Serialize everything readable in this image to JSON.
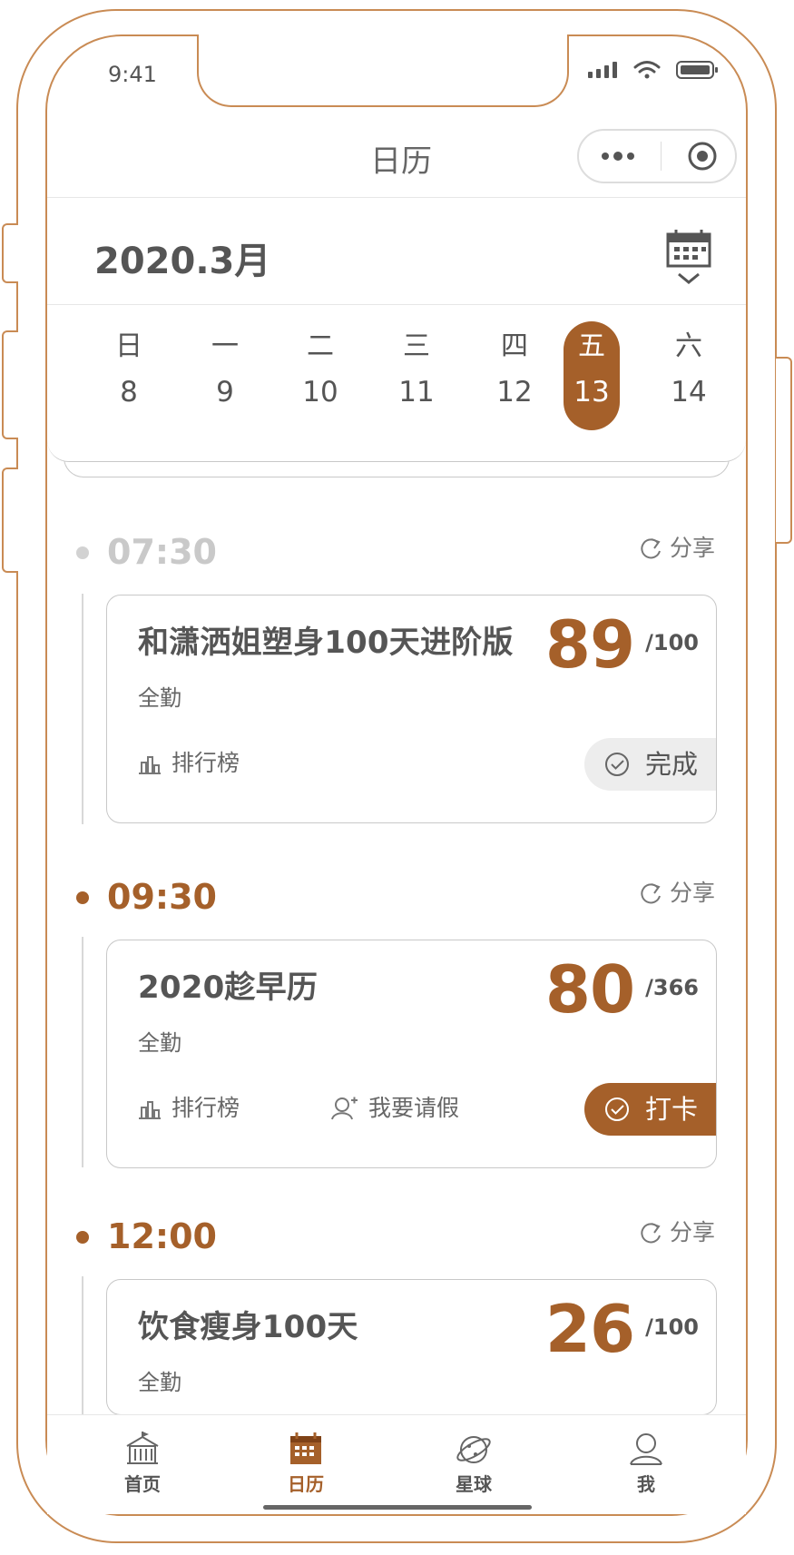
{
  "status_bar": {
    "time": "9:41"
  },
  "nav": {
    "title": "日历"
  },
  "calendar": {
    "month": "2020.3月",
    "days": [
      {
        "weekday": "日",
        "date": "8",
        "selected": false
      },
      {
        "weekday": "一",
        "date": "9",
        "selected": false
      },
      {
        "weekday": "二",
        "date": "10",
        "selected": false
      },
      {
        "weekday": "三",
        "date": "11",
        "selected": false
      },
      {
        "weekday": "四",
        "date": "12",
        "selected": false
      },
      {
        "weekday": "五",
        "date": "13",
        "selected": true
      },
      {
        "weekday": "六",
        "date": "14",
        "selected": false
      }
    ]
  },
  "schedule": [
    {
      "time": "07:30",
      "time_color": "#c9c9c9",
      "share_label": "分享",
      "title": "和潇洒姐塑身100天进阶版",
      "subtitle": "全勤",
      "score": "89",
      "score_total": "/100",
      "actions": [
        "排行榜"
      ],
      "button_label": "完成",
      "button_state": "done"
    },
    {
      "time": "09:30",
      "time_color": "#a5602a",
      "share_label": "分享",
      "title": "2020趁早历",
      "subtitle": "全勤",
      "score": "80",
      "score_total": "/366",
      "actions": [
        "排行榜",
        "我要请假"
      ],
      "button_label": "打卡",
      "button_state": "checkin"
    },
    {
      "time": "12:00",
      "time_color": "#a5602a",
      "share_label": "分享",
      "title": "饮食瘦身100天",
      "subtitle": "全勤",
      "score": "26",
      "score_total": "/100"
    }
  ],
  "tabbar": {
    "items": [
      {
        "label": "首页",
        "icon": "home-icon",
        "active": false
      },
      {
        "label": "日历",
        "icon": "calendar-icon",
        "active": true
      },
      {
        "label": "星球",
        "icon": "planet-icon",
        "active": false
      },
      {
        "label": "我",
        "icon": "profile-icon",
        "active": false
      }
    ]
  },
  "colors": {
    "accent": "#a5602a",
    "outline": "#c98b54",
    "muted_time": "#c9c9c9"
  }
}
